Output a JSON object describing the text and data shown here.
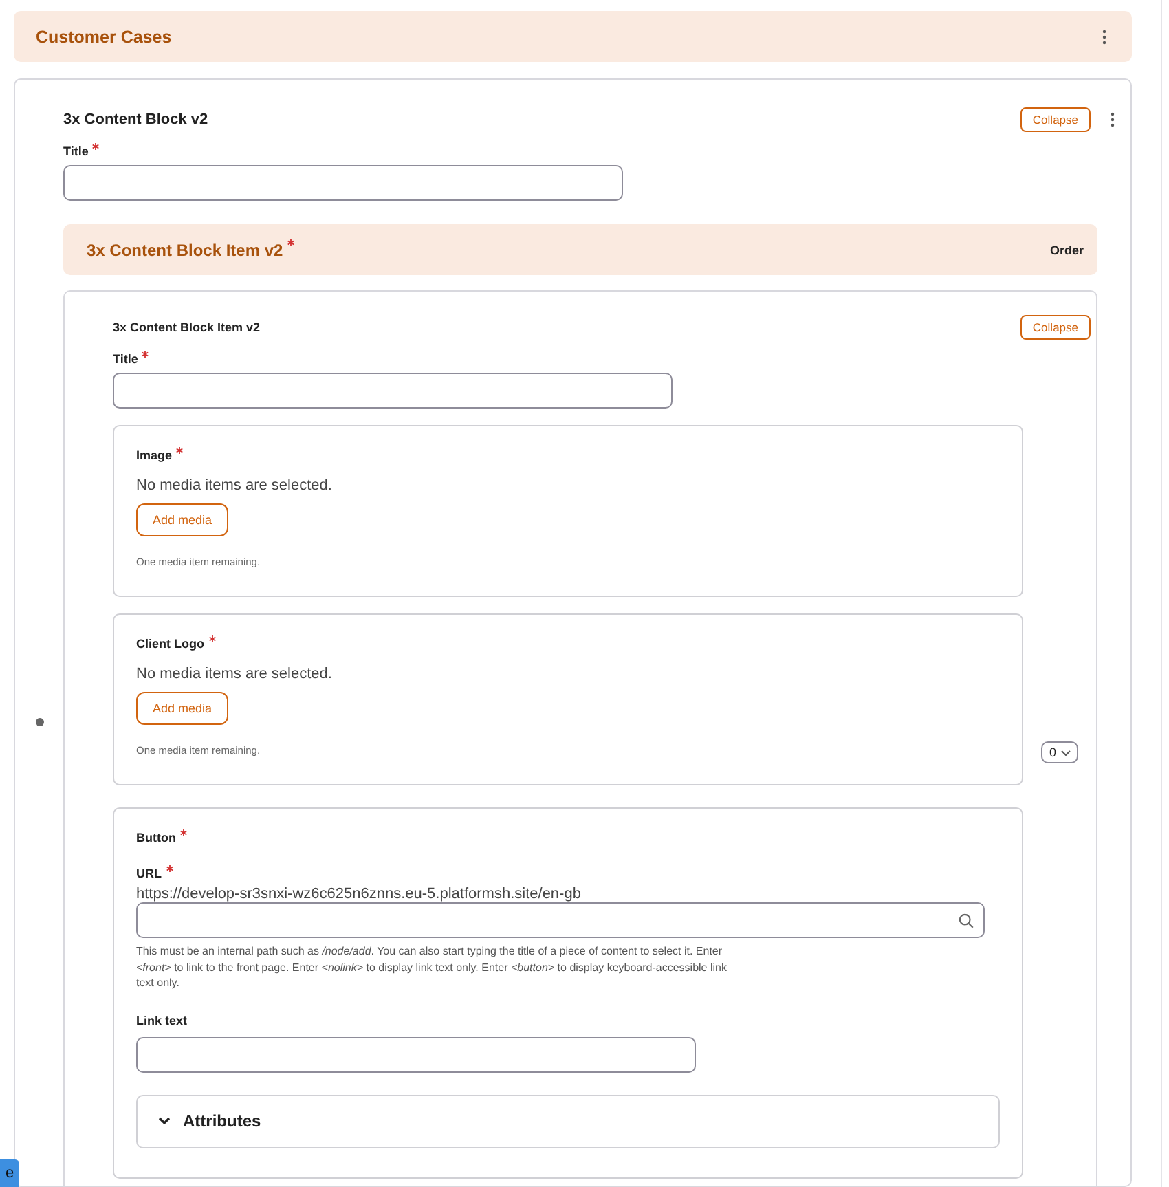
{
  "header": {
    "title": "Customer Cases"
  },
  "block": {
    "title": "3x Content Block v2",
    "collapse": "Collapse",
    "title_field": {
      "label": "Title",
      "required": true
    }
  },
  "items_header": {
    "title": "3x Content Block Item v2",
    "required": true,
    "order": "Order"
  },
  "item": {
    "title": "3x Content Block Item v2",
    "collapse": "Collapse",
    "title_field": {
      "label": "Title",
      "required": true
    },
    "media": [
      {
        "label": "Image",
        "required": true,
        "status": "No media items are selected.",
        "button": "Add media",
        "remaining": "One media item remaining."
      },
      {
        "label": "Client Logo",
        "required": true,
        "status": "No media items are selected.",
        "button": "Add media",
        "remaining": "One media item remaining."
      }
    ],
    "weight": "0",
    "button_group": {
      "label": "Button",
      "required": true,
      "url": {
        "label": "URL",
        "required": true,
        "prefix": "https://develop-sr3snxi-wz6c625n6znns.eu-5.platformsh.site/en-gb",
        "description": "This must be an internal path such as */node/add*. You can also start typing the title of a piece of content to select it. Enter *<front>* to link to the front page. Enter *<nolink>* to display link text only. Enter *<button>* to display keyboard-accessible link text only."
      },
      "link_text": {
        "label": "Link text",
        "required": false
      },
      "attributes": {
        "label": "Attributes",
        "expanded": false
      }
    }
  },
  "corner_tab": {
    "label": "e"
  }
}
